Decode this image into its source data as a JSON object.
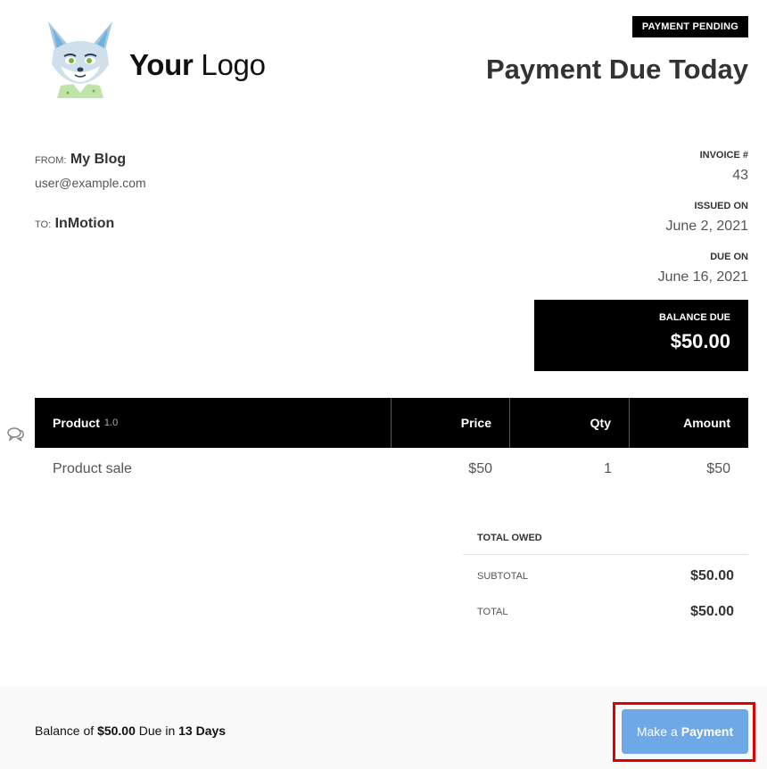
{
  "header": {
    "logo_bold": "Your",
    "logo_light": "Logo",
    "status_badge": "PAYMENT PENDING",
    "title": "Payment Due Today"
  },
  "parties": {
    "from_label": "FROM:",
    "from_name": "My Blog",
    "from_email": "user@example.com",
    "to_label": "TO:",
    "to_name": "InMotion"
  },
  "meta": {
    "invoice_label": "INVOICE #",
    "invoice_value": "43",
    "issued_label": "ISSUED ON",
    "issued_value": "June 2, 2021",
    "due_label": "DUE ON",
    "due_value": "June 16, 2021",
    "balance_label": "BALANCE DUE",
    "balance_value": "$50.00"
  },
  "items": {
    "headers": {
      "product": "Product",
      "version": "1.0",
      "price": "Price",
      "qty": "Qty",
      "amount": "Amount"
    },
    "rows": [
      {
        "product": "Product sale",
        "price": "$50",
        "qty": "1",
        "amount": "$50"
      }
    ]
  },
  "totals": {
    "heading": "TOTAL OWED",
    "subtotal_label": "SUBTOTAL",
    "subtotal_value": "$50.00",
    "total_label": "TOTAL",
    "total_value": "$50.00"
  },
  "footer": {
    "prefix": "Balance of",
    "amount": "$50.00",
    "middle": "Due in",
    "days": "13 Days",
    "pay_light": "Make a",
    "pay_bold": "Payment"
  },
  "colors": {
    "badge_bg": "#000000",
    "pay_button": "#6fa8e6",
    "highlight_outline": "#e00000"
  },
  "icons": {
    "logo": "fox-mascot-icon",
    "comment": "comment-bubbles-icon"
  }
}
